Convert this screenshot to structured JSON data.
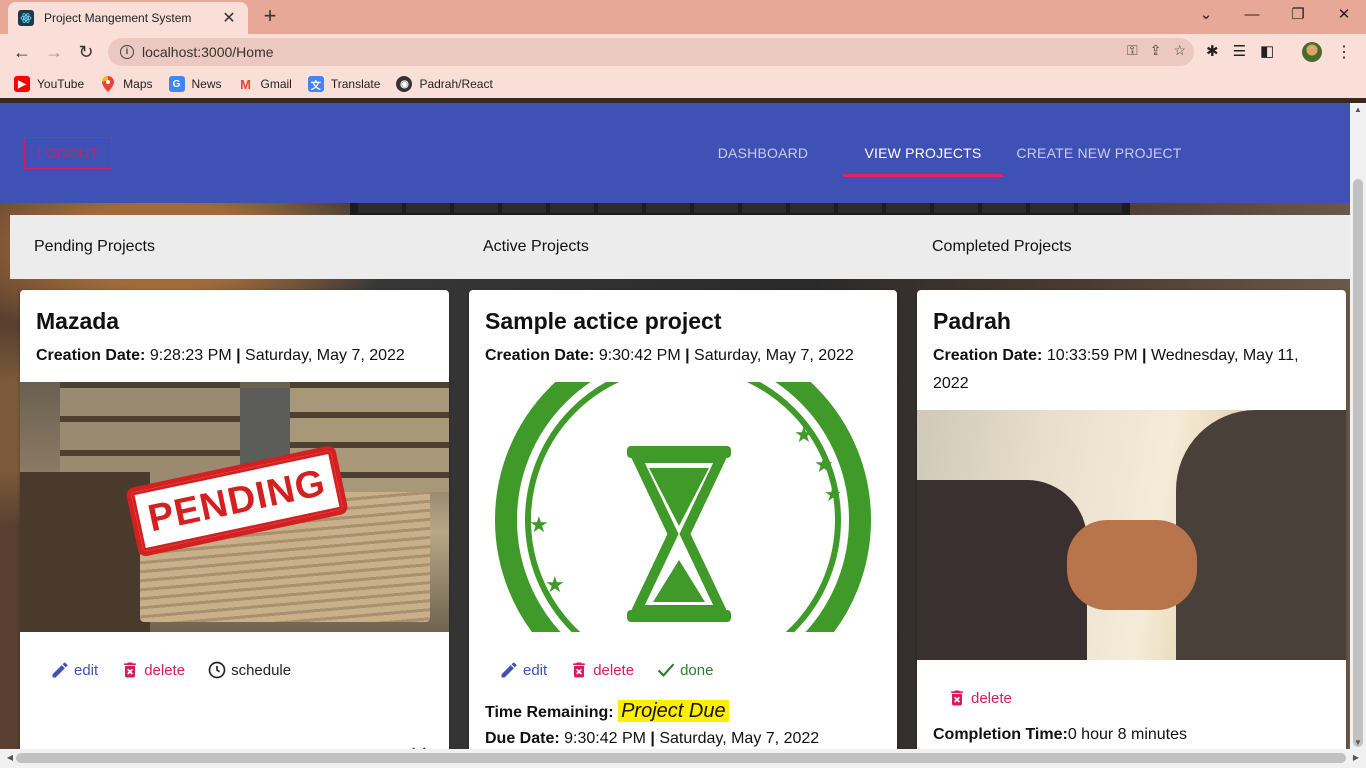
{
  "browser": {
    "tab_title": "Project Mangement System",
    "url": "localhost:3000/Home",
    "bookmarks": [
      "YouTube",
      "Maps",
      "News",
      "Gmail",
      "Translate",
      "Padrah/React"
    ]
  },
  "appbar": {
    "logout": "LOGOUT",
    "nav": [
      "DASHBOARD",
      "VIEW PROJECTS",
      "CREATE NEW PROJECT"
    ],
    "active_nav": "VIEW PROJECTS"
  },
  "columns": [
    "Pending Projects",
    "Active Projects",
    "Completed Projects"
  ],
  "cards": {
    "pending": {
      "title": "Mazada",
      "date_label": "Creation Date:",
      "date_time": "9:28:23 PM",
      "date_day": "Saturday, May 7, 2022",
      "image_text": "PENDING",
      "actions": [
        "edit",
        "delete",
        "schedule"
      ]
    },
    "active": {
      "title": "Sample actice project",
      "date_label": "Creation Date:",
      "date_time": "9:30:42 PM",
      "date_day": "Saturday, May 7, 2022",
      "actions": [
        "edit",
        "delete",
        "done"
      ],
      "remaining_label": "Time Remaining:",
      "remaining_value": "Project Due",
      "due_label": "Due Date:",
      "due_time": "9:30:42 PM",
      "due_day": "Saturday, May 7, 2022"
    },
    "completed": {
      "title": "Padrah",
      "date_label": "Creation Date:",
      "date_time": "10:33:59 PM",
      "date_day": "Wednesday, May 11, 2022",
      "actions": [
        "delete"
      ],
      "completion_label": "Completion Time:",
      "completion_value": "0 hour 8 minutes"
    }
  },
  "colors": {
    "appbar": "#3f51b5",
    "accent": "#e91e63",
    "edit": "#3f51b5",
    "delete": "#d81b60",
    "done": "#2e7d32",
    "due_highlight": "#ffee00"
  }
}
